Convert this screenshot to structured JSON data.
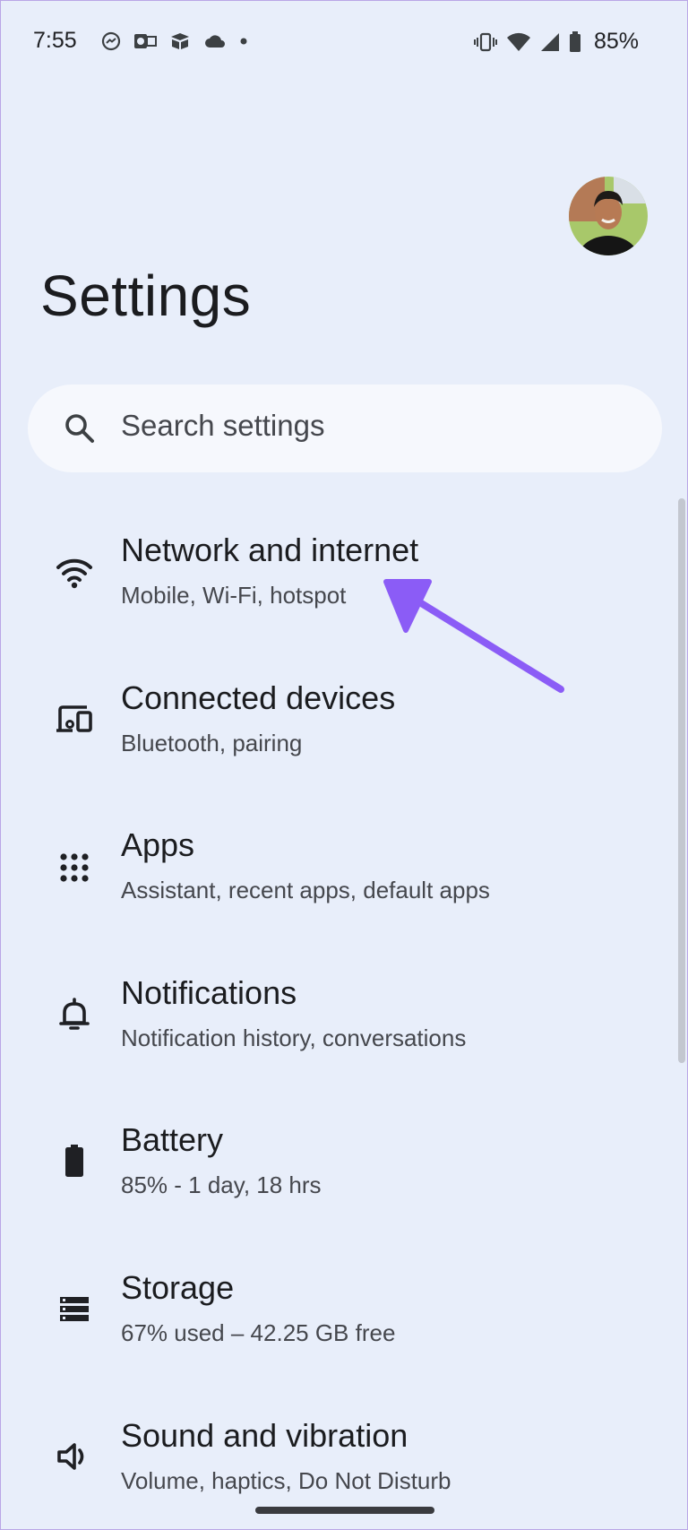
{
  "status_bar": {
    "time": "7:55",
    "battery_percent": "85%",
    "left_icons": [
      "messenger-icon",
      "outlook-icon",
      "airtable-icon",
      "cloud-icon",
      "dot-icon"
    ],
    "right_icons": [
      "vibrate-icon",
      "wifi-icon",
      "signal-icon",
      "battery-icon"
    ]
  },
  "header": {
    "title": "Settings"
  },
  "search": {
    "placeholder": "Search settings"
  },
  "settings": [
    {
      "title": "Network and internet",
      "subtitle": "Mobile, Wi-Fi, hotspot",
      "icon": "wifi-icon"
    },
    {
      "title": "Connected devices",
      "subtitle": "Bluetooth, pairing",
      "icon": "devices-icon"
    },
    {
      "title": "Apps",
      "subtitle": "Assistant, recent apps, default apps",
      "icon": "apps-grid-icon"
    },
    {
      "title": "Notifications",
      "subtitle": "Notification history, conversations",
      "icon": "bell-icon"
    },
    {
      "title": "Battery",
      "subtitle": "85% - 1 day, 18 hrs",
      "icon": "battery-icon"
    },
    {
      "title": "Storage",
      "subtitle": "67% used – 42.25 GB free",
      "icon": "storage-icon"
    },
    {
      "title": "Sound and vibration",
      "subtitle": "Volume, haptics, Do Not Disturb",
      "icon": "speaker-icon"
    }
  ],
  "colors": {
    "background": "#e8eefa",
    "search_background": "#f6f8fd",
    "annotation_arrow": "#8b5cf6"
  }
}
